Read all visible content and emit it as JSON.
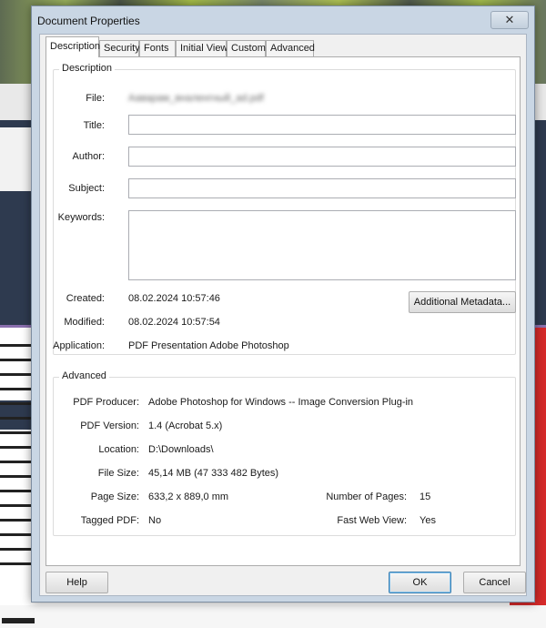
{
  "window": {
    "title": "Document Properties",
    "close_glyph": "✕"
  },
  "tabs": [
    {
      "label": "Description"
    },
    {
      "label": "Security"
    },
    {
      "label": "Fonts"
    },
    {
      "label": "Initial View"
    },
    {
      "label": "Custom"
    },
    {
      "label": "Advanced"
    }
  ],
  "description": {
    "group_title": "Description",
    "file_label": "File:",
    "file_value": "Ааварам_вналенгный_ad.pdf",
    "title_label": "Title:",
    "title_value": "",
    "author_label": "Author:",
    "author_value": "",
    "subject_label": "Subject:",
    "subject_value": "",
    "keywords_label": "Keywords:",
    "keywords_value": "",
    "created_label": "Created:",
    "created_value": "08.02.2024 10:57:46",
    "modified_label": "Modified:",
    "modified_value": "08.02.2024 10:57:54",
    "application_label": "Application:",
    "application_value": "PDF Presentation Adobe Photoshop",
    "metadata_button": "Additional Metadata..."
  },
  "advanced": {
    "group_title": "Advanced",
    "producer_label": "PDF Producer:",
    "producer_value": "Adobe Photoshop for Windows -- Image Conversion Plug-in",
    "version_label": "PDF Version:",
    "version_value": "1.4 (Acrobat 5.x)",
    "location_label": "Location:",
    "location_value": "D:\\Downloads\\",
    "filesize_label": "File Size:",
    "filesize_value": "45,14 MB (47 333 482 Bytes)",
    "pagesize_label": "Page Size:",
    "pagesize_value": "633,2 x 889,0 mm",
    "numpages_label": "Number of Pages:",
    "numpages_value": "15",
    "tagged_label": "Tagged PDF:",
    "tagged_value": "No",
    "fastweb_label": "Fast Web View:",
    "fastweb_value": "Yes"
  },
  "buttons": {
    "help": "Help",
    "ok": "OK",
    "cancel": "Cancel"
  },
  "colors": {
    "dialog_frame": "#c9d6e4",
    "client_bg": "#f0f0f0",
    "panel_bg": "#ffffff",
    "ok_border": "#3c7fb1"
  }
}
